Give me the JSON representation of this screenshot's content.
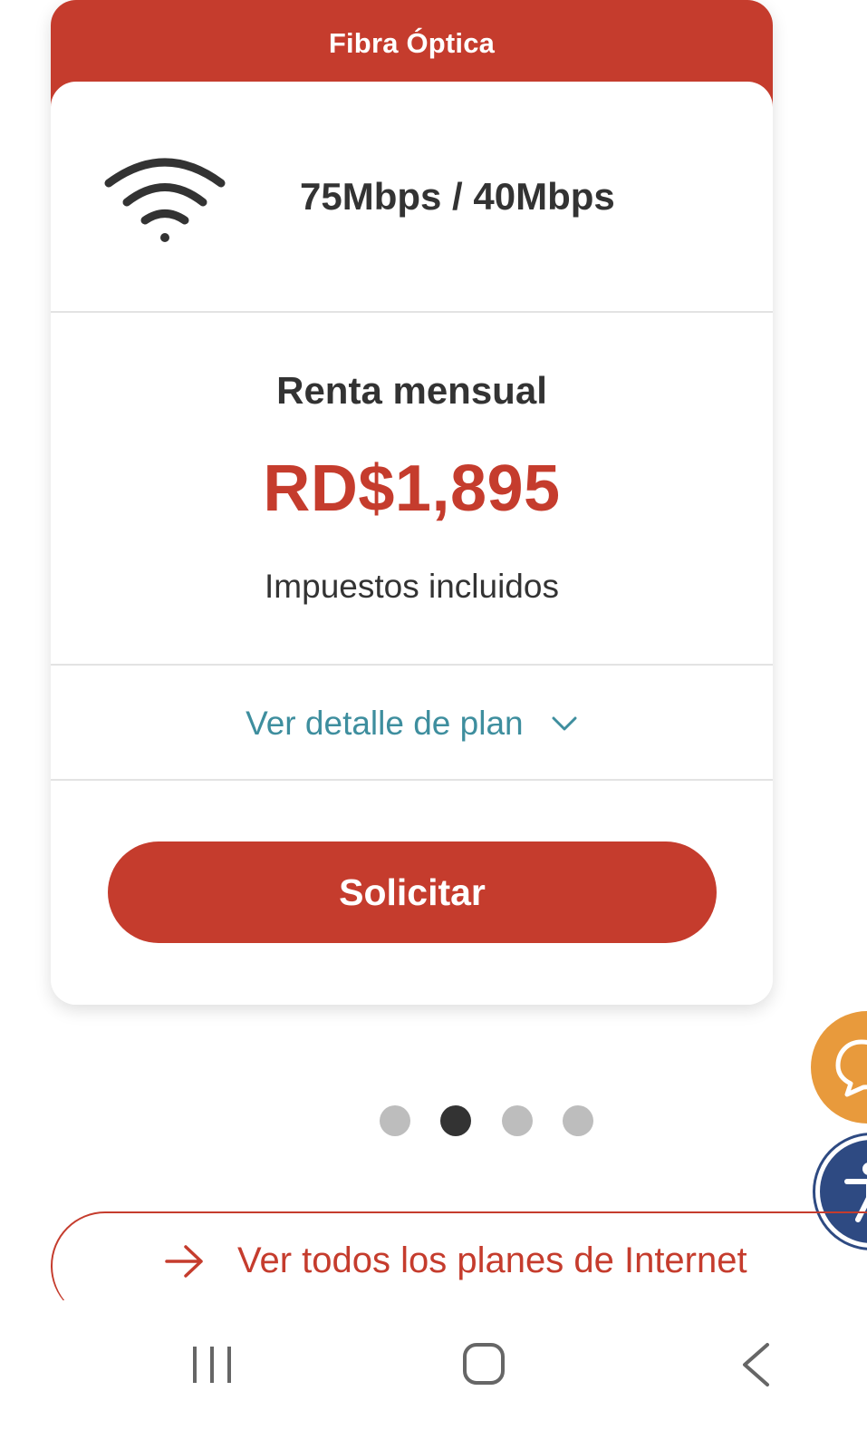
{
  "plan_card": {
    "title": "Fibra Óptica",
    "speed": "75Mbps / 40Mbps",
    "price_label": "Renta mensual",
    "price": "RD$1,895",
    "tax_note": "Impuestos incluidos",
    "detail_link": "Ver detalle de plan",
    "request_button": "Solicitar",
    "icon": "wifi-icon"
  },
  "carousel": {
    "total_slides": 4,
    "active_index": 1
  },
  "all_plans_link": {
    "label": "Ver todos los planes de Internet",
    "icon": "arrow-right-icon"
  },
  "floating_buttons": {
    "chat_icon": "chat-bubble-icon",
    "accessibility_icon": "accessibility-icon"
  },
  "navbar": {
    "icons": [
      "recents-icon",
      "home-icon",
      "back-icon"
    ]
  },
  "colors": {
    "brand_red": "#c53c2d",
    "link_teal": "#3e8e9e",
    "chat_orange": "#e89a3c",
    "access_blue": "#2e4a82",
    "text_dark": "#333333",
    "dot_inactive": "#bdbdbd"
  }
}
